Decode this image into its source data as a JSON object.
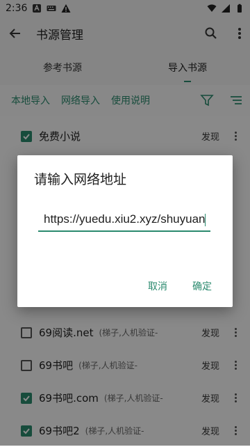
{
  "status_bar": {
    "time": "2:36"
  },
  "toolbar": {
    "title": "书源管理",
    "back_icon": "arrow-left-icon",
    "search_icon": "search-icon",
    "more_icon": "more-vert-icon"
  },
  "tabs": [
    {
      "label": "参考书源",
      "active": false
    },
    {
      "label": "导入书源",
      "active": true
    }
  ],
  "filter_bar": {
    "local_import": "本地导入",
    "network_import": "网络导入",
    "usage": "使用说明"
  },
  "sources": [
    {
      "name": "免费小说",
      "note": "",
      "checked": true,
      "action": "发现"
    },
    {
      "name": "",
      "note": "",
      "checked": false,
      "action": ""
    },
    {
      "name": "",
      "note": "",
      "checked": false,
      "action": ""
    },
    {
      "name": "",
      "note": "",
      "checked": false,
      "action": ""
    },
    {
      "name": "",
      "note": "",
      "checked": false,
      "action": ""
    },
    {
      "name": "",
      "note": "",
      "checked": true,
      "action": ""
    },
    {
      "name": "69阅读.net",
      "note": "(梯子,人机验证-",
      "checked": false,
      "action": "发现"
    },
    {
      "name": "69书吧",
      "note": "(梯子,人机验证-",
      "checked": false,
      "action": "发现"
    },
    {
      "name": "69书吧.com",
      "note": "(梯子,人机验证-",
      "checked": true,
      "action": "发现"
    },
    {
      "name": "69书吧2",
      "note": "(梯子,人机验证-",
      "checked": true,
      "action": "发现"
    }
  ],
  "dialog": {
    "title": "请输入网络地址",
    "url_value": "https://yuedu.xiu2.xyz/shuyuan",
    "cancel_label": "取消",
    "confirm_label": "确定"
  },
  "colors": {
    "accent": "#2a8a6e"
  }
}
